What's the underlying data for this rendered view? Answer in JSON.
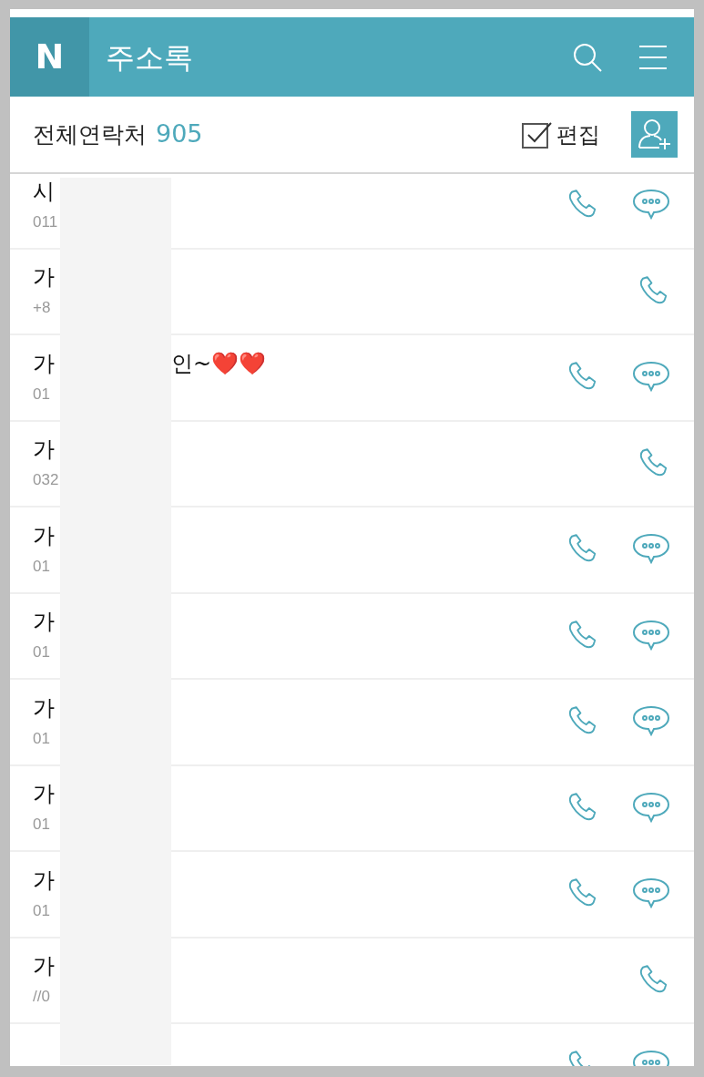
{
  "header": {
    "logo": "N",
    "title": "주소록"
  },
  "subheader": {
    "label": "전체연락처",
    "count": "905",
    "edit": "편집"
  },
  "contacts": [
    {
      "name": "시",
      "phone": "011",
      "has_chat": true
    },
    {
      "name": "가",
      "phone": "+8",
      "has_chat": false
    },
    {
      "name": "가",
      "name_end": "인~❤️❤️",
      "phone": "01",
      "has_chat": true
    },
    {
      "name": "가",
      "phone": "032",
      "has_chat": false
    },
    {
      "name": "가",
      "phone": "01",
      "has_chat": true
    },
    {
      "name": "가",
      "phone": "01",
      "has_chat": true
    },
    {
      "name": "가",
      "phone": "01",
      "has_chat": true
    },
    {
      "name": "가",
      "phone": "01",
      "has_chat": true
    },
    {
      "name": "가",
      "phone": "01",
      "has_chat": true
    },
    {
      "name": "가",
      "phone": "//0",
      "has_chat": false
    },
    {
      "has_chat": true
    }
  ]
}
